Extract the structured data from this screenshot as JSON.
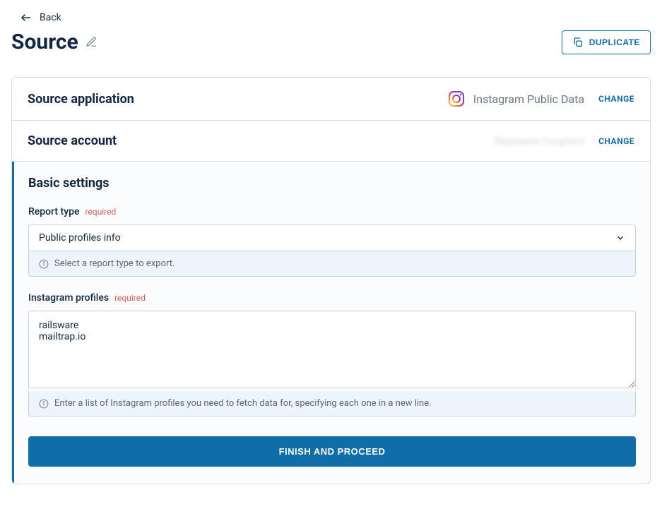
{
  "nav": {
    "back_label": "Back"
  },
  "header": {
    "title": "Source",
    "duplicate_label": "DUPLICATE"
  },
  "source_app": {
    "title": "Source application",
    "app_name": "Instagram Public Data",
    "change_label": "CHANGE"
  },
  "source_account": {
    "title": "Source account",
    "account_name_masked": "Railsware Couplers",
    "change_label": "CHANGE"
  },
  "settings": {
    "heading": "Basic settings",
    "report_type": {
      "label": "Report type",
      "required_label": "required",
      "value": "Public profiles info",
      "hint": "Select a report type to export."
    },
    "profiles": {
      "label": "Instagram profiles",
      "required_label": "required",
      "value": "railsware\nmailtrap.io",
      "hint": "Enter a list of Instagram profiles you need to fetch data for, specifying each one in a new line."
    },
    "finish_label": "FINISH AND PROCEED"
  }
}
